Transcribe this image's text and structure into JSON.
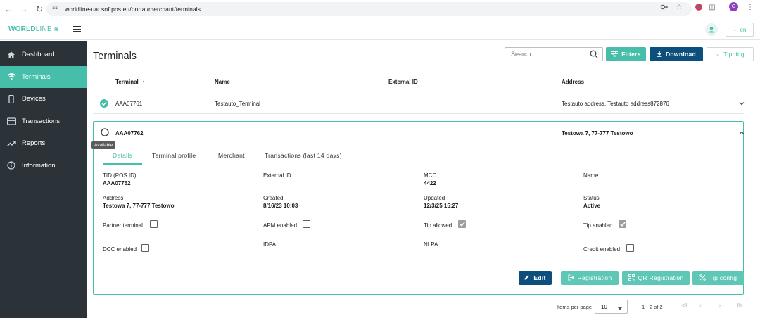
{
  "browser": {
    "url": "worldline-uat.softpos.eu/portal/merchant/terminals",
    "profile_initial": "G"
  },
  "header": {
    "logo_bold": "WORLD",
    "logo_light": "LINE",
    "language": "en"
  },
  "sidebar": {
    "items": [
      {
        "label": "Dashboard",
        "icon": "home-icon"
      },
      {
        "label": "Terminals",
        "icon": "wifi-icon",
        "active": true
      },
      {
        "label": "Devices",
        "icon": "phone-icon"
      },
      {
        "label": "Transactions",
        "icon": "card-icon"
      },
      {
        "label": "Reports",
        "icon": "trending-icon"
      },
      {
        "label": "Information",
        "icon": "info-icon"
      }
    ]
  },
  "page": {
    "title": "Terminals",
    "search_placeholder": "Search",
    "filters_label": "Filters",
    "download_label": "Download",
    "tipping_label": "Tipping"
  },
  "table": {
    "columns": [
      "Terminal",
      "Name",
      "External ID",
      "Address"
    ],
    "rows": [
      {
        "terminal": "AAA07761",
        "name": "Testauto_Terminal",
        "external_id": "",
        "address": "Testauto address, Testauto address872876",
        "status": "active"
      },
      {
        "terminal": "AAA07762",
        "name": "",
        "external_id": "",
        "address": "Testowa 7, 77-777 Testowo",
        "status": "available"
      }
    ]
  },
  "details": {
    "tooltip": "Available",
    "tabs": [
      "Details",
      "Terminal profile",
      "Merchant",
      "Transactions (last 14 days)"
    ],
    "fields": {
      "tid_label": "TID (POS ID)",
      "tid_value": "AAA07762",
      "external_id_label": "External ID",
      "external_id_value": "",
      "mcc_label": "MCC",
      "mcc_value": "4422",
      "name_label": "Name",
      "name_value": "",
      "address_label": "Address",
      "address_value": "Testowa 7, 77-777 Testowo",
      "created_label": "Created",
      "created_value": "8/16/23 10:03",
      "updated_label": "Updated",
      "updated_value": "12/3/25 15:27",
      "status_label": "Status",
      "status_value": "Active",
      "partner_terminal_label": "Partner terminal",
      "apm_enabled_label": "APM enabled",
      "tip_allowed_label": "Tip allowed",
      "tip_enabled_label": "Tip enabled",
      "dcc_enabled_label": "DCC enabled",
      "idpa_label": "IDPA",
      "nlpa_label": "NLPA",
      "credit_enabled_label": "Credit enabled"
    },
    "checkboxes": {
      "partner_terminal": false,
      "apm_enabled": false,
      "tip_allowed": true,
      "tip_enabled": true,
      "dcc_enabled": false,
      "credit_enabled": false
    },
    "actions": {
      "edit": "Edit",
      "registration": "Registration",
      "qr_registration": "QR Registration",
      "tip_config": "Tip config"
    }
  },
  "pagination": {
    "items_per_page_label": "Items per page",
    "items_per_page": "10",
    "range": "1 - 2 of 2"
  },
  "colors": {
    "accent": "#46beaa",
    "navy": "#0d4f7c",
    "sidebar_bg": "#2b3238"
  }
}
